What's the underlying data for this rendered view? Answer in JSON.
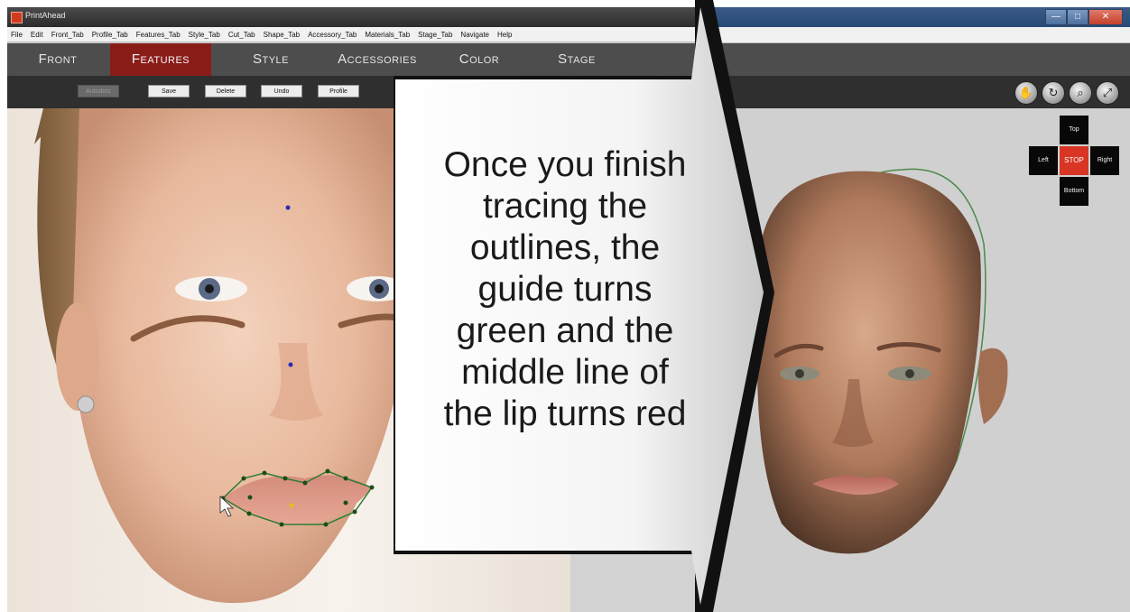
{
  "left_window": {
    "title": "PrintAhead",
    "menu": [
      "File",
      "Edit",
      "Front_Tab",
      "Profile_Tab",
      "Features_Tab",
      "Style_Tab",
      "Cut_Tab",
      "Shape_Tab",
      "Accessory_Tab",
      "Materials_Tab",
      "Stage_Tab",
      "Navigate",
      "Help"
    ],
    "tabs": [
      {
        "label": "Front",
        "active": false
      },
      {
        "label": "Features",
        "active": true
      },
      {
        "label": "Style",
        "active": false
      },
      {
        "label": "Accessories",
        "active": false
      },
      {
        "label": "Color",
        "active": false
      },
      {
        "label": "Stage",
        "active": false
      }
    ],
    "toolbar": {
      "autodots": "Autodots",
      "save": "Save",
      "delete": "Delete",
      "undo": "Undo",
      "profile": "Profile"
    }
  },
  "right_window": {
    "window_buttons": {
      "minimize": "—",
      "maximize": "□",
      "close": "✕"
    },
    "tool_icons": [
      "hand-icon",
      "rotate-icon",
      "zoom-icon",
      "fit-icon"
    ],
    "navigation": {
      "top": "Top",
      "left": "Left",
      "stop": "STOP",
      "right": "Right",
      "bottom": "Bottom"
    }
  },
  "callout": {
    "lines": [
      "Once you finish",
      "tracing the",
      "outlines, the",
      "guide turns",
      "green and the",
      "middle line of",
      "the lip turns red"
    ]
  },
  "colors": {
    "tab_active": "#8a1c18",
    "tab_bar": "#4d4d4d",
    "toolbar": "#2f2f2f",
    "stop_button": "#d83524",
    "guide_outline": "#2e7d32",
    "guide_dot": "#1b4d1b",
    "landmark_dot": "#2a2ab8"
  }
}
